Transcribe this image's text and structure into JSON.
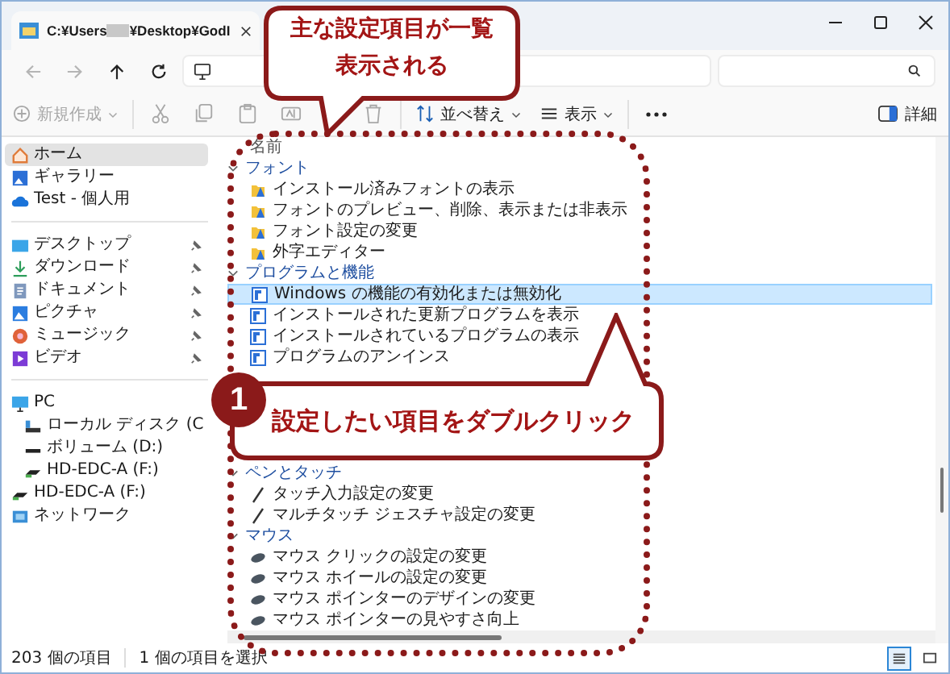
{
  "tab": {
    "title_before_redaction": "C:¥Users",
    "title_after_redaction": "¥Desktop¥GodI"
  },
  "nav": [
    {
      "kind": "back",
      "disabled": true
    },
    {
      "kind": "forward",
      "disabled": true
    },
    {
      "kind": "up",
      "disabled": false
    },
    {
      "kind": "refresh",
      "disabled": false
    }
  ],
  "toolbar": {
    "new": {
      "label": "新規作成",
      "disabled": true
    },
    "edit_actions": [
      {
        "kind": "cut",
        "disabled": true
      },
      {
        "kind": "copy",
        "disabled": true
      },
      {
        "kind": "paste",
        "disabled": true
      },
      {
        "kind": "rename",
        "disabled": true
      },
      {
        "kind": "delete",
        "disabled": true
      }
    ],
    "sort": {
      "label": "並べ替え"
    },
    "view": {
      "label": "表示"
    },
    "details": {
      "label": "詳細"
    }
  },
  "sidebar": {
    "sections": [
      [
        {
          "kind": "home",
          "label": "ホーム",
          "selected": true,
          "pinned": false
        },
        {
          "kind": "gallery",
          "label": "ギャラリー",
          "selected": false,
          "pinned": false
        },
        {
          "kind": "cloud",
          "label": "Test - 個人用",
          "selected": false,
          "pinned": false
        }
      ],
      [
        {
          "kind": "desktop",
          "label": "デスクトップ",
          "selected": false,
          "pinned": true
        },
        {
          "kind": "download",
          "label": "ダウンロード",
          "selected": false,
          "pinned": true
        },
        {
          "kind": "documents",
          "label": "ドキュメント",
          "selected": false,
          "pinned": true
        },
        {
          "kind": "pictures",
          "label": "ピクチャ",
          "selected": false,
          "pinned": true
        },
        {
          "kind": "music",
          "label": "ミュージック",
          "selected": false,
          "pinned": true
        },
        {
          "kind": "video",
          "label": "ビデオ",
          "selected": false,
          "pinned": true
        }
      ],
      [
        {
          "kind": "pc",
          "label": "PC",
          "selected": false,
          "pinned": false,
          "children": [
            {
              "kind": "drive",
              "label": "ローカル ディスク (C",
              "selected": false,
              "pinned": false
            },
            {
              "kind": "volume",
              "label": "ボリューム (D:)",
              "selected": false,
              "pinned": false
            },
            {
              "kind": "usb",
              "label": "HD-EDC-A (F:)",
              "selected": false,
              "pinned": false
            }
          ]
        },
        {
          "kind": "usb",
          "label": "HD-EDC-A (F:)",
          "selected": false,
          "pinned": false
        },
        {
          "kind": "network",
          "label": "ネットワーク",
          "selected": false,
          "pinned": false
        }
      ]
    ]
  },
  "main": {
    "column_header": "名前",
    "groups": [
      {
        "title": "フォント",
        "items": [
          {
            "kind": "font",
            "label": "インストール済みフォントの表示",
            "selected": false
          },
          {
            "kind": "font",
            "label": "フォントのプレビュー、削除、表示または非表示",
            "selected": false
          },
          {
            "kind": "font",
            "label": "フォント設定の変更",
            "selected": false
          },
          {
            "kind": "font",
            "label": "外字エディター",
            "selected": false
          }
        ]
      },
      {
        "title": "プログラムと機能",
        "items": [
          {
            "kind": "program",
            "label": "Windows の機能の有効化または無効化",
            "selected": true
          },
          {
            "kind": "program",
            "label": "インストールされた更新プログラムを表示",
            "selected": false
          },
          {
            "kind": "program",
            "label": "インストールされているプログラムの表示",
            "selected": false
          },
          {
            "kind": "program",
            "label": "プログラムのアンインス",
            "selected": false
          }
        ]
      },
      {
        "title": "ペンとタッチ",
        "items": [
          {
            "kind": "pen",
            "label": "タッチ入力設定の変更",
            "selected": false
          },
          {
            "kind": "pen",
            "label": "マルチタッチ ジェスチャ設定の変更",
            "selected": false
          }
        ]
      },
      {
        "title": "マウス",
        "items": [
          {
            "kind": "mouse",
            "label": "マウス クリックの設定の変更",
            "selected": false
          },
          {
            "kind": "mouse",
            "label": "マウス ホイールの設定の変更",
            "selected": false
          },
          {
            "kind": "mouse",
            "label": "マウス ポインターのデザインの変更",
            "selected": false
          },
          {
            "kind": "mouse",
            "label": "マウス ポインターの見やすさ向上",
            "selected": false
          }
        ]
      }
    ]
  },
  "status_bar": {
    "item_count": "203 個の項目",
    "selection": "1 個の項目を選択",
    "views": [
      {
        "kind": "details",
        "selected": true
      },
      {
        "kind": "tiles",
        "selected": false
      }
    ]
  },
  "summary_callout": {
    "lines": [
      "主な設定項目が一覧",
      "表示される"
    ]
  },
  "step_callout": {
    "number": "1",
    "text": "設定したい項目をダブルクリック"
  }
}
